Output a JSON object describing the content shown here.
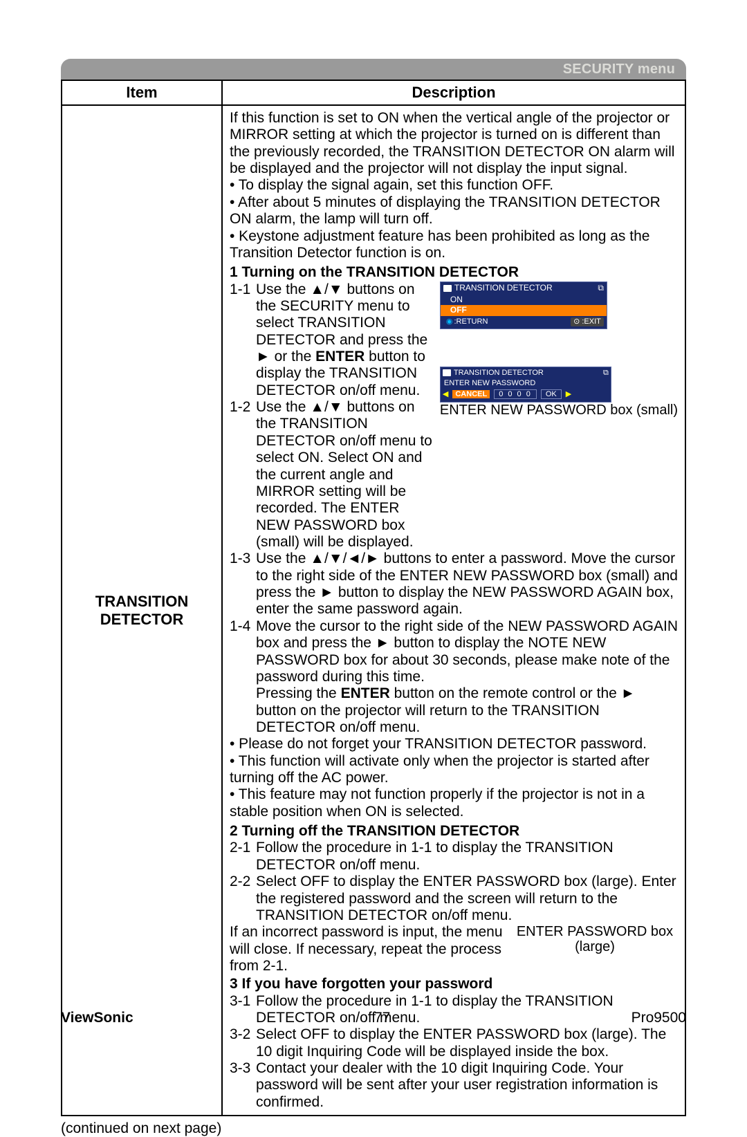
{
  "header": {
    "title": "SECURITY menu"
  },
  "table": {
    "headers": {
      "item": "Item",
      "description": "Description"
    },
    "row": {
      "item_line1": "TRANSITION",
      "item_line2": "DETECTOR",
      "intro": {
        "p1": "If this function is set to ON when the vertical angle of the projector or MIRROR setting at which the projector is turned on is different than the previously recorded, the TRANSITION DETECTOR ON alarm will be displayed and the projector will not display the input signal.",
        "b1": "• To display the signal again, set this function OFF.",
        "b2": "• After about 5 minutes of displaying the TRANSITION DETECTOR ON alarm, the lamp will turn off.",
        "b3": "• Keystone adjustment feature has been prohibited as long as the Transition Detector function is on."
      },
      "sec1": {
        "title": "1 Turning on the TRANSITION DETECTOR",
        "s1_num": "1-1",
        "s1_a": "Use the ▲/▼ buttons on the SECURITY menu to select TRANSITION DETECTOR and press the ► or the ",
        "s1_enter": "ENTER",
        "s1_b": " button to display the TRANSITION DETECTOR on/off menu.",
        "s2_num": "1-2",
        "s2": "Use the ▲/▼ buttons on the TRANSITION DETECTOR on/off menu to select ON. Select ON and the current angle and MIRROR setting will be recorded. The ENTER NEW PASSWORD box (small) will be displayed.",
        "s3_num": "1-3",
        "s3": "Use the ▲/▼/◄/► buttons to enter a password. Move the cursor to the right side of the ENTER NEW PASSWORD box (small) and press the ► button to display the NEW PASSWORD AGAIN box, enter the same password again.",
        "s4_num": "1-4",
        "s4_a": "Move the cursor to the right side of the NEW PASSWORD AGAIN box and press the ► button to display the NOTE NEW PASSWORD box for about 30 seconds, please make note of the password during this time.",
        "s4_b_pre": "Pressing the ",
        "s4_b_bold": "ENTER",
        "s4_b_post": " button on the remote control or the ► button on the projector will return to the TRANSITION DETECTOR on/off menu.",
        "n1": "• Please do not forget your TRANSITION DETECTOR password.",
        "n2": "• This function will activate only when the projector is started after turning off the AC power.",
        "n3": "• This feature may not function properly if the projector is not in a stable position when ON is selected."
      },
      "sec2": {
        "title": "2 Turning off the TRANSITION DETECTOR",
        "s1_num": "2-1",
        "s1": "Follow the procedure in 1-1 to display the TRANSITION DETECTOR on/off menu.",
        "s2_num": "2-2",
        "s2": "Select OFF to display the ENTER PASSWORD box (large). Enter the registered password and the screen will return to the TRANSITION DETECTOR on/off menu.",
        "note": "If an incorrect password is input, the menu will close. If necessary, repeat the process from 2-1.",
        "caption": "ENTER PASSWORD box (large)"
      },
      "sec3": {
        "title": "3 If you have forgotten your password",
        "s1_num": "3-1",
        "s1": "Follow the procedure in 1-1 to display the TRANSITION DETECTOR on/off menu.",
        "s2_num": "3-2",
        "s2": "Select OFF to display the ENTER PASSWORD box (large). The 10 digit Inquiring Code will be displayed inside the box.",
        "s3_num": "3-3",
        "s3": "Contact your dealer with the 10 digit Inquiring Code. Your password will be sent after your user registration information is confirmed."
      },
      "osd1": {
        "title": "TRANSITION DETECTOR",
        "on": "ON",
        "off": "OFF",
        "return": ":RETURN",
        "exit": ":EXIT"
      },
      "osd2": {
        "title": "TRANSITION DETECTOR",
        "msg": "ENTER NEW PASSWORD",
        "cancel": "CANCEL",
        "code": "0 0 0 0",
        "ok": "OK",
        "caption": "ENTER NEW PASSWORD box (small)"
      }
    }
  },
  "continued": "(continued on next page)",
  "footer": {
    "brand": "ViewSonic",
    "page": "77",
    "model": "Pro9500"
  }
}
